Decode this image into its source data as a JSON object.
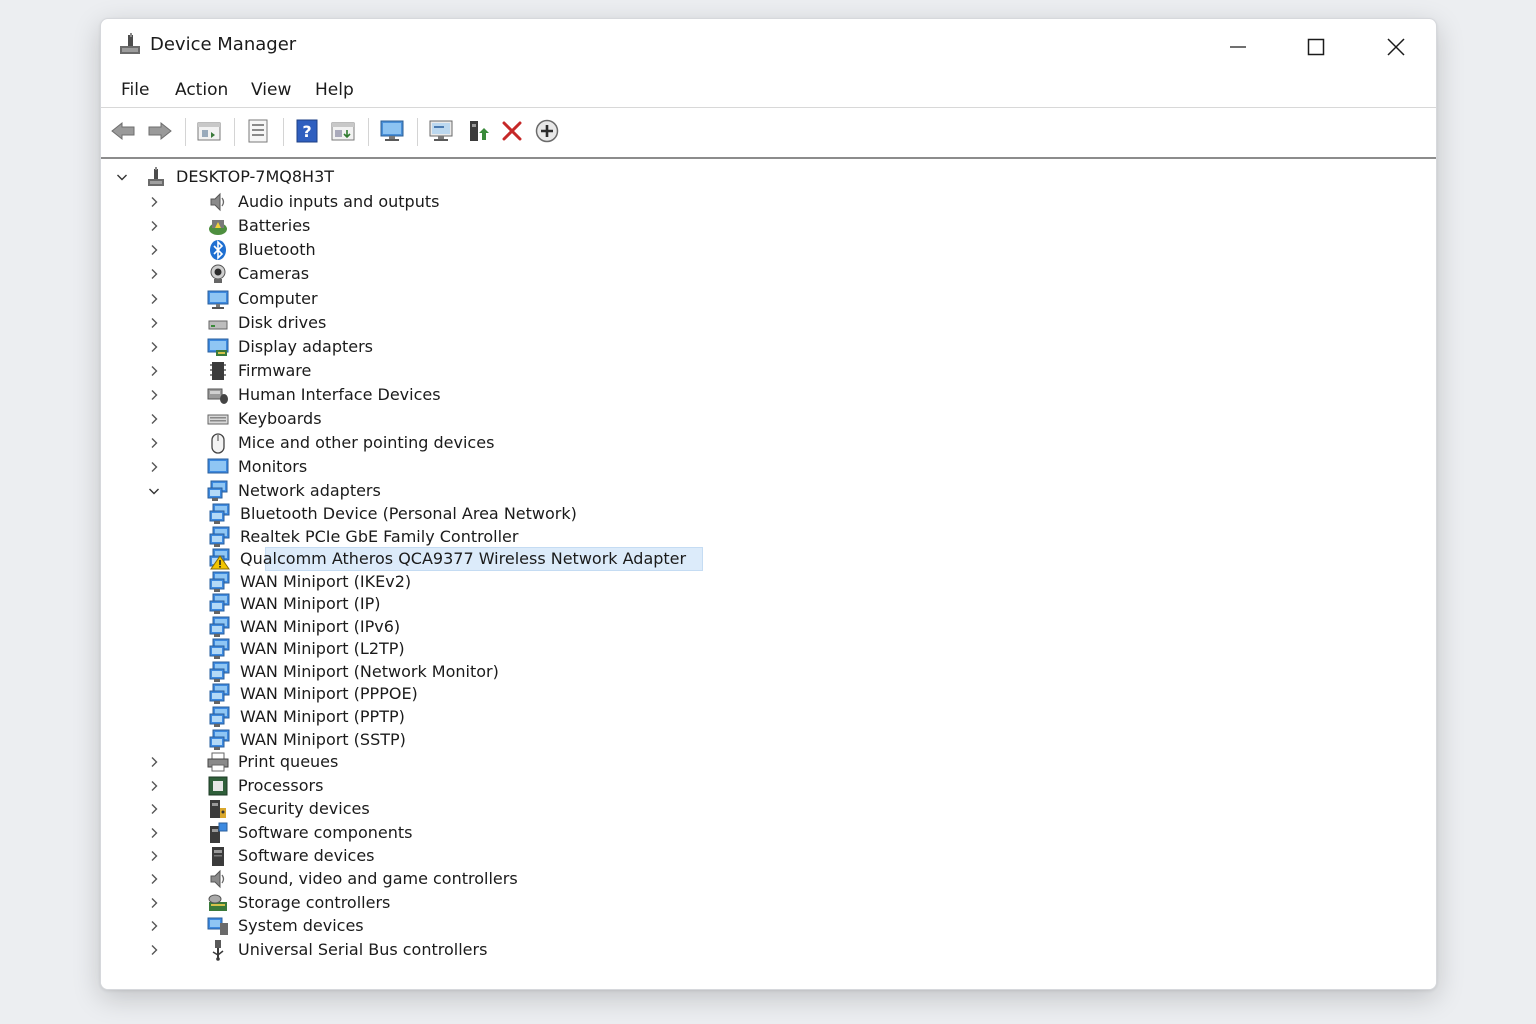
{
  "window": {
    "title": "Device Manager",
    "icon": "device-manager-icon"
  },
  "menu": [
    "File",
    "Action",
    "View",
    "Help"
  ],
  "toolbar": {
    "icons": [
      "back-arrow-icon",
      "forward-arrow-icon",
      "show-hide-tree-icon",
      "properties-icon",
      "help-icon",
      "action-view-icon",
      "scan-hardware-icon",
      "update-driver-icon",
      "enable-device-icon",
      "uninstall-device-icon",
      "add-device-icon"
    ]
  },
  "tree": {
    "root": "DESKTOP-7MQ8H3T",
    "categories_before": [
      {
        "label": "Audio inputs and outputs",
        "icon": "speaker-icon"
      },
      {
        "label": "Batteries",
        "icon": "battery-icon"
      },
      {
        "label": "Bluetooth",
        "icon": "bluetooth-icon"
      },
      {
        "label": "Cameras",
        "icon": "camera-icon"
      },
      {
        "label": "Computer",
        "icon": "computer-icon"
      },
      {
        "label": "Disk drives",
        "icon": "disk-drive-icon"
      },
      {
        "label": "Display adapters",
        "icon": "display-adapter-icon"
      },
      {
        "label": "Firmware",
        "icon": "firmware-icon"
      },
      {
        "label": "Human Interface Devices",
        "icon": "hid-icon"
      },
      {
        "label": "Keyboards",
        "icon": "keyboard-icon"
      },
      {
        "label": "Mice and other pointing devices",
        "icon": "mouse-icon"
      },
      {
        "label": "Monitors",
        "icon": "monitor-icon"
      }
    ],
    "expanded": {
      "label": "Network adapters",
      "icon": "network-adapter-icon",
      "children": [
        {
          "label": "Bluetooth Device (Personal Area Network)"
        },
        {
          "label": "Realtek PCIe GbE Family Controller"
        },
        {
          "label": "Qualcomm Atheros QCA9377 Wireless Network Adapter",
          "selected": true,
          "warning": true
        },
        {
          "label": "WAN Miniport (IKEv2)"
        },
        {
          "label": "WAN Miniport (IP)"
        },
        {
          "label": "WAN Miniport (IPv6)"
        },
        {
          "label": "WAN Miniport (L2TP)"
        },
        {
          "label": "WAN Miniport (Network Monitor)"
        },
        {
          "label": "WAN Miniport (PPPOE)"
        },
        {
          "label": "WAN Miniport (PPTP)"
        },
        {
          "label": "WAN Miniport (SSTP)"
        }
      ]
    },
    "categories_after": [
      {
        "label": "Print queues",
        "icon": "printer-icon"
      },
      {
        "label": "Processors",
        "icon": "processor-icon"
      },
      {
        "label": "Security devices",
        "icon": "security-device-icon"
      },
      {
        "label": "Software components",
        "icon": "software-component-icon"
      },
      {
        "label": "Software devices",
        "icon": "software-device-icon"
      },
      {
        "label": "Sound, video and game controllers",
        "icon": "sound-icon"
      },
      {
        "label": "Storage controllers",
        "icon": "storage-controller-icon"
      },
      {
        "label": "System devices",
        "icon": "system-device-icon"
      },
      {
        "label": "Universal Serial Bus controllers",
        "icon": "usb-icon"
      }
    ]
  },
  "colors": {
    "selection": "#dcebfa",
    "accent": "#1a73c8",
    "warning": "#f2c500"
  }
}
